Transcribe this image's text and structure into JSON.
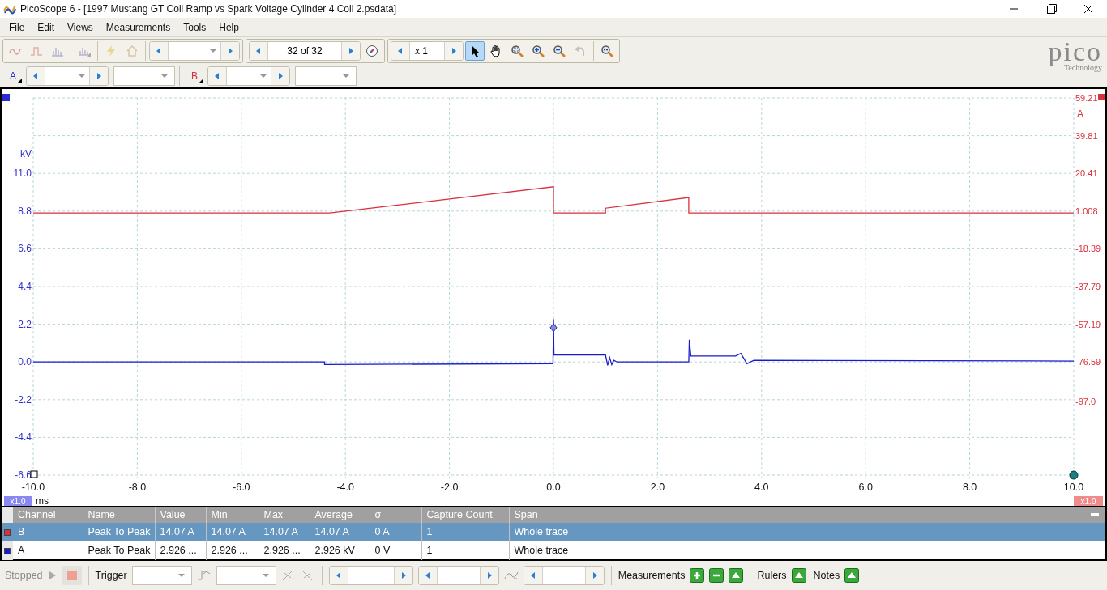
{
  "window": {
    "title": "PicoScope 6 - [1997 Mustang GT Coil Ramp vs Spark Voltage Cylinder 4 Coil 2.psdata]"
  },
  "menu": [
    "File",
    "Edit",
    "Views",
    "Measurements",
    "Tools",
    "Help"
  ],
  "toolbar": {
    "mode_tools": [
      {
        "kind": "scope",
        "disabled": true
      },
      {
        "kind": "persistence",
        "disabled": true
      },
      {
        "kind": "spectrum",
        "disabled": true
      },
      {
        "kind": "spectrum-persistence",
        "disabled": true
      },
      {
        "kind": "auto-setup",
        "disabled": true
      },
      {
        "kind": "default-setup",
        "disabled": true
      }
    ],
    "buffer_counter": "32 of 32",
    "zoom_factor": "x 1",
    "view_tools": [
      {
        "kind": "pointer",
        "selected": true,
        "disabled": false
      },
      {
        "kind": "hand",
        "selected": false,
        "disabled": false
      },
      {
        "kind": "zoom-area",
        "selected": false,
        "disabled": false
      },
      {
        "kind": "zoom-in",
        "selected": false,
        "disabled": false
      },
      {
        "kind": "zoom-out",
        "selected": false,
        "disabled": false
      },
      {
        "kind": "undo-zoom",
        "selected": false,
        "disabled": true
      },
      {
        "kind": "zoom-full",
        "selected": false,
        "disabled": false
      }
    ]
  },
  "channels": [
    {
      "label": "A",
      "color": "#2b2bd6"
    },
    {
      "label": "B",
      "color": "#d9313f"
    }
  ],
  "logo": {
    "brand": "pico",
    "tagline": "Technology"
  },
  "scope": {
    "right_unit": "A",
    "left_scale": "x1.0",
    "right_scale": "x1.0",
    "chart_data": {
      "type": "line",
      "grid": true,
      "xlabel": "ms",
      "ylabel": "kV",
      "xlim": [
        -10,
        10
      ],
      "ylim": [
        -6.6,
        15.4
      ],
      "y2lim": [
        -134.79,
        59.21
      ],
      "xticks": [
        {
          "value": -10,
          "label": "-10.0"
        },
        {
          "value": -8,
          "label": "-8.0"
        },
        {
          "value": -6,
          "label": "-6.0"
        },
        {
          "value": -4,
          "label": "-4.0"
        },
        {
          "value": -2,
          "label": "-2.0"
        },
        {
          "value": 0,
          "label": "0.0"
        },
        {
          "value": 2,
          "label": "2.0"
        },
        {
          "value": 4,
          "label": "4.0"
        },
        {
          "value": 6,
          "label": "6.0"
        },
        {
          "value": 8,
          "label": "8.0"
        },
        {
          "value": 10,
          "label": "10.0"
        }
      ],
      "yticks": [
        {
          "value": 11,
          "label": "11.0"
        },
        {
          "value": 8.8,
          "label": "8.8"
        },
        {
          "value": 6.6,
          "label": "6.6"
        },
        {
          "value": 4.4,
          "label": "4.4"
        },
        {
          "value": 2.2,
          "label": "2.2"
        },
        {
          "value": 0,
          "label": "0.0"
        },
        {
          "value": -2.2,
          "label": "-2.2"
        },
        {
          "value": -4.4,
          "label": "-4.4"
        },
        {
          "value": -6.6,
          "label": "-6.6"
        }
      ],
      "y2ticks": [
        {
          "value": 59.21,
          "label": "59.21"
        },
        {
          "value": 39.81,
          "label": "39.81"
        },
        {
          "value": 20.41,
          "label": "20.41"
        },
        {
          "value": 1.008,
          "label": "1.008"
        },
        {
          "value": -18.39,
          "label": "-18.39"
        },
        {
          "value": -37.79,
          "label": "-37.79"
        },
        {
          "value": -57.19,
          "label": "-57.19"
        },
        {
          "value": -76.59,
          "label": "-76.59"
        },
        {
          "value": -97.0,
          "label": "-97.0"
        }
      ],
      "series": [
        {
          "color": "#1a1ac8",
          "x": [
            -10,
            -4.4,
            -4.4,
            -0.01,
            0,
            0.01,
            1.0,
            1.04,
            1.08,
            1.12,
            1.16,
            1.22,
            1.3,
            2.6,
            2.61,
            2.64,
            3.5,
            3.6,
            3.72,
            3.85,
            10
          ],
          "values": [
            0,
            0,
            -0.15,
            -0.1,
            2.5,
            0.4,
            0.4,
            -0.2,
            0.25,
            -0.15,
            0.1,
            0,
            0,
            0,
            1.3,
            0.35,
            0.35,
            0.5,
            -0.1,
            0.1,
            0.05
          ]
        },
        {
          "color": "#d9313f",
          "axis": "y2",
          "x": [
            -10,
            -4.3,
            0,
            0,
            1.0,
            1.0,
            2.6,
            2.6,
            10
          ],
          "values": [
            0,
            0,
            13.5,
            0,
            0,
            2.5,
            8.0,
            0,
            0
          ]
        }
      ]
    }
  },
  "measurements": {
    "columns": [
      "Channel",
      "Name",
      "Value",
      "Min",
      "Max",
      "Average",
      "σ",
      "Capture Count",
      "Span"
    ],
    "rows": [
      {
        "color": "#d9313f",
        "selected": true,
        "cells": [
          "B",
          "Peak To Peak",
          "14.07 A",
          "14.07 A",
          "14.07 A",
          "14.07 A",
          "0 A",
          "1",
          "Whole trace"
        ]
      },
      {
        "color": "#1a1ac8",
        "selected": false,
        "cells": [
          "A",
          "Peak To Peak",
          "2.926 ...",
          "2.926 ...",
          "2.926 ...",
          "2.926 kV",
          "0 V",
          "1",
          "Whole trace"
        ]
      }
    ]
  },
  "status_bar": {
    "run_state": "Stopped",
    "trigger_label": "Trigger",
    "measurements_label": "Measurements",
    "rulers_label": "Rulers",
    "notes_label": "Notes"
  }
}
